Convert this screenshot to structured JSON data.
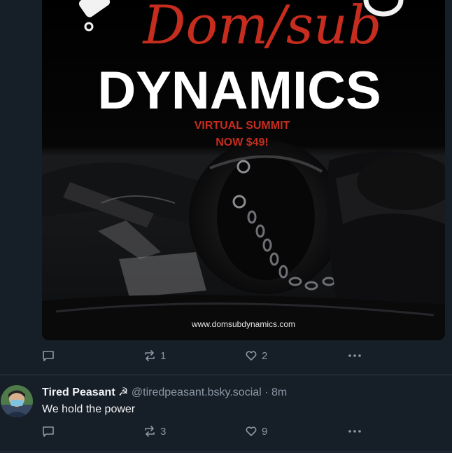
{
  "post1": {
    "image": {
      "headline_script": "Dom/sub",
      "headline_main": "DYNAMICS",
      "subtitle_line1": "VIRTUAL SUMMIT",
      "subtitle_line2": "NOW $49!",
      "url": "www.domsubdynamics.com"
    },
    "actions": {
      "reply_count": "",
      "repost_count": "1",
      "like_count": "2"
    }
  },
  "post2": {
    "author": "Tired Peasant",
    "author_glyph": "☭",
    "handle": "@tiredpeasant.bsky.social",
    "separator": "·",
    "time": "8m",
    "text": "We hold the power",
    "actions": {
      "reply_count": "",
      "repost_count": "3",
      "like_count": "9"
    }
  },
  "colors": {
    "background": "#161e27",
    "accent_red": "#c62d1f",
    "muted": "#8b98a5",
    "divider": "#2e3b49"
  }
}
